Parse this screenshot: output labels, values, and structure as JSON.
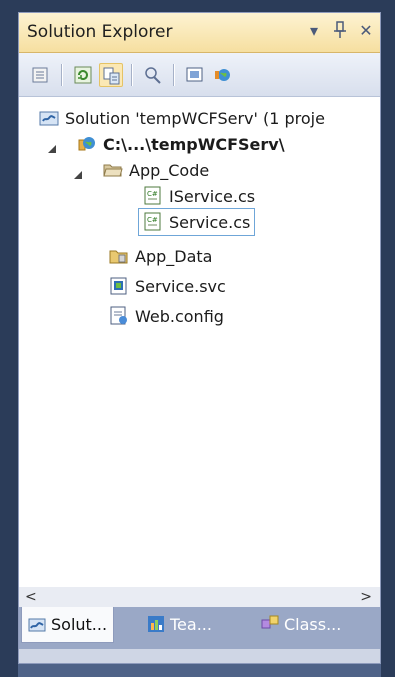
{
  "panel": {
    "title": "Solution Explorer",
    "pin_icon": "pin-icon",
    "close_icon": "close-icon"
  },
  "toolbar": {
    "items": [
      "properties-icon",
      "refresh-icon",
      "show-all-files-icon",
      "view-class-diagram-icon",
      "nest-related-files-icon",
      "web-project-icon"
    ]
  },
  "tree": {
    "solution": "Solution 'tempWCFServ' (1 proje",
    "project": "C:\\...\\tempWCFServ\\",
    "app_code": "App_Code",
    "iservice": "IService.cs",
    "service_cs": "Service.cs",
    "app_data": "App_Data",
    "service_svc": "Service.svc",
    "web_config": "Web.config"
  },
  "tabs": {
    "solution": "Solut...",
    "team": "Tea...",
    "class": "Class..."
  },
  "colors": {
    "title_bg": "#f8e3a8",
    "selection_border": "#6fa6d8",
    "tab_strip_bg": "#9aa8c6"
  }
}
